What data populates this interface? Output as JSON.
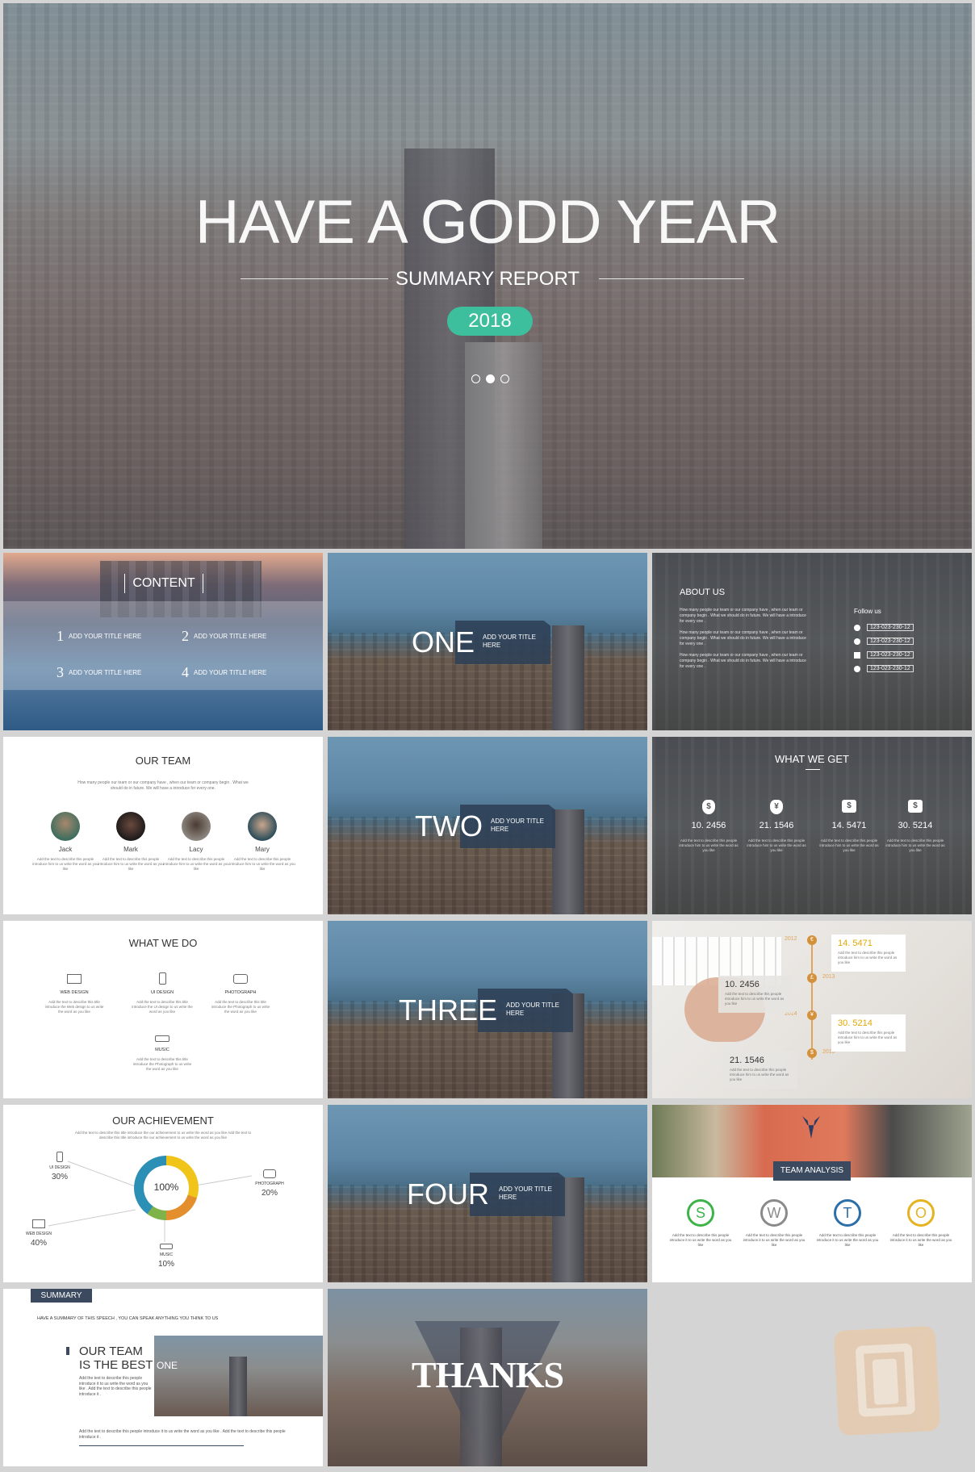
{
  "hero": {
    "title": "HAVE A GODD YEAR",
    "subtitle": "SUMMARY REPORT",
    "year": "2018",
    "accent": "#3dbf9e"
  },
  "content": {
    "title": "CONTENT",
    "items": [
      {
        "num": "1",
        "label": "ADD YOUR TITLE HERE"
      },
      {
        "num": "2",
        "label": "ADD YOUR TITLE HERE"
      },
      {
        "num": "3",
        "label": "ADD YOUR TITLE HERE"
      },
      {
        "num": "4",
        "label": "ADD YOUR TITLE HERE"
      }
    ]
  },
  "sections": [
    {
      "big": "ONE",
      "label1": "ADD YOUR TITLE",
      "label2": "HERE"
    },
    {
      "big": "TWO",
      "label1": "ADD YOUR TITLE",
      "label2": "HERE"
    },
    {
      "big": "THREE",
      "label1": "ADD YOUR TITLE",
      "label2": "HERE"
    },
    {
      "big": "FOUR",
      "label1": "ADD YOUR TITLE",
      "label2": "HERE"
    }
  ],
  "about": {
    "title": "ABOUT US",
    "para": "How many people our team or our company have , when our team or company begin . What we should do in future. We will have a introduce for every one .",
    "follow": "Follow us",
    "phones": [
      "123-023-230-12",
      "123-023-230-12",
      "123-023-230-12",
      "123-023-230-12"
    ]
  },
  "team": {
    "title": "OUR TEAM",
    "desc": "How many people our team or our company have , when our team or company begin . What we should do in future. We will have a introduce for every one.",
    "members": [
      {
        "name": "Jack"
      },
      {
        "name": "Mark"
      },
      {
        "name": "Lacy"
      },
      {
        "name": "Mary"
      }
    ],
    "member_desc": "Add the text to describe this people introduce him to us write the word as you like"
  },
  "get": {
    "title": "WHAT WE GET",
    "stats": [
      {
        "icon": "$",
        "value": "10. 2456"
      },
      {
        "icon": "¥",
        "value": "21. 1546"
      },
      {
        "icon": "$",
        "value": "14. 5471"
      },
      {
        "icon": "$",
        "value": "30. 5214"
      }
    ],
    "desc": "Add the text to describe this people introduce him to us write the word as you like"
  },
  "do": {
    "title": "WHAT WE DO",
    "items": [
      {
        "label": "WEB DESIGN",
        "desc": "Add the text to describe this title introduce the Web design to us write the word as you like"
      },
      {
        "label": "UI DESIGN",
        "desc": "Add the text to describe this title introduce the UI design to us write the word as you like"
      },
      {
        "label": "PHOTOGRAPH",
        "desc": "Add the text to describe this title introduce the Photograph to us write the word as you like"
      },
      {
        "label": "MUSIC",
        "desc": "Add the text to describe this title introduce the Photograph to us write the word as you like"
      }
    ]
  },
  "timeline": {
    "cards": [
      {
        "year": "2012",
        "value": "14. 5471"
      },
      {
        "year": "2013",
        "value": "10. 2456"
      },
      {
        "year": "2014",
        "value": "30. 5214"
      },
      {
        "year": "2015",
        "value": "21. 1546"
      }
    ],
    "desc": "Add the text to describe this people introduce him to us write the word as you like"
  },
  "achievement": {
    "title": "OUR ACHIEVEMENT",
    "desc": "Add the text to describe this title introduce the our achievement to us write the word as you like Add the text to describe this title introduce the our achievement to us write the word as you like",
    "center": "100%",
    "items": [
      {
        "label": "UI DESIGN",
        "pct": "30%"
      },
      {
        "label": "WEB DESIGN",
        "pct": "40%"
      },
      {
        "label": "MUSIC",
        "pct": "10%"
      },
      {
        "label": "PHOTOGRAPH",
        "pct": "20%"
      }
    ]
  },
  "analysis": {
    "title": "TEAM ANALYSIS",
    "letters": [
      {
        "l": "S",
        "color": "#3db34a"
      },
      {
        "l": "W",
        "color": "#8a8a8a"
      },
      {
        "l": "T",
        "color": "#2c6fa8"
      },
      {
        "l": "O",
        "color": "#e6b320"
      }
    ],
    "desc": "Add the text to describe this people introduce it to us write the word as you like"
  },
  "summary": {
    "badge": "SUMMARY",
    "intro": "HAVE A SUMMARY OF THIS SPEECH , YOU CAN SPEAK ANYTHING YOU THINK TO US",
    "head1": "OUR TEAM",
    "head2": "IS THE BEST",
    "one": "ONE",
    "body": "Add the text to describe this people introduce it to us write the word as you like . Add the text to describe this people introduce it .",
    "foot": "Add the text to describe this people introduce it to us write the word as you like . Add the text to describe this people introduce it ."
  },
  "thanks": {
    "text": "THANKS"
  }
}
